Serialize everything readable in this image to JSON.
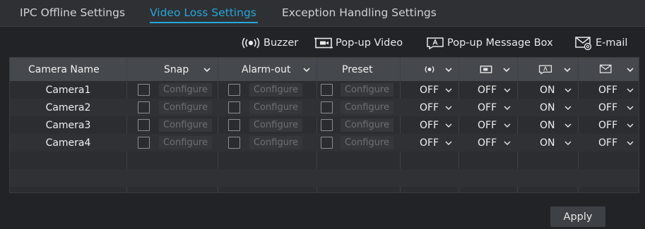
{
  "tabs": [
    {
      "label": "IPC Offline Settings",
      "active": false
    },
    {
      "label": "Video Loss Settings",
      "active": true
    },
    {
      "label": "Exception Handling Settings",
      "active": false
    }
  ],
  "legend": {
    "buzzer": "Buzzer",
    "popup_video": "Pop-up Video",
    "popup_message": "Pop-up Message Box",
    "email": "E-mail"
  },
  "table": {
    "headers": {
      "camera_name": "Camera Name",
      "snap": "Snap",
      "alarm_out": "Alarm-out",
      "preset": "Preset"
    },
    "rows": [
      {
        "camera": "Camera1",
        "snap_btn": "Configure",
        "alarm_btn": "Configure",
        "preset_btn": "Configure",
        "buzzer": "OFF",
        "popup_video": "OFF",
        "popup_msg": "ON",
        "email": "OFF"
      },
      {
        "camera": "Camera2",
        "snap_btn": "Configure",
        "alarm_btn": "Configure",
        "preset_btn": "Configure",
        "buzzer": "OFF",
        "popup_video": "OFF",
        "popup_msg": "ON",
        "email": "OFF"
      },
      {
        "camera": "Camera3",
        "snap_btn": "Configure",
        "alarm_btn": "Configure",
        "preset_btn": "Configure",
        "buzzer": "OFF",
        "popup_video": "OFF",
        "popup_msg": "ON",
        "email": "OFF"
      },
      {
        "camera": "Camera4",
        "snap_btn": "Configure",
        "alarm_btn": "Configure",
        "preset_btn": "Configure",
        "buzzer": "OFF",
        "popup_video": "OFF",
        "popup_msg": "ON",
        "email": "OFF"
      }
    ]
  },
  "apply_label": "Apply",
  "colors": {
    "accent": "#27a6d8",
    "background": "#212326",
    "header": "#45484d"
  },
  "icons": [
    "buzzer-icon",
    "popup-video-icon",
    "popup-message-icon",
    "email-icon",
    "chevron-down-icon"
  ]
}
